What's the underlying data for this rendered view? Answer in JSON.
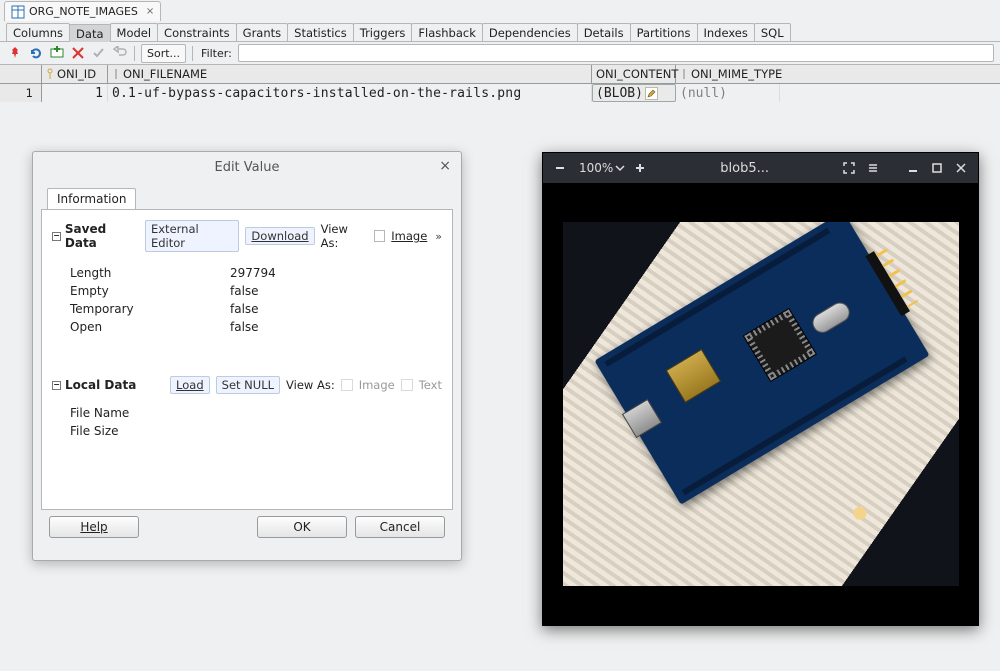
{
  "editor_tab": {
    "label": "ORG_NOTE_IMAGES"
  },
  "subtabs": [
    "Columns",
    "Data",
    "Model",
    "Constraints",
    "Grants",
    "Statistics",
    "Triggers",
    "Flashback",
    "Dependencies",
    "Details",
    "Partitions",
    "Indexes",
    "SQL"
  ],
  "subtabs_active_index": 1,
  "toolbar": {
    "sort_label": "Sort...",
    "filter_label": "Filter:",
    "filter_value": ""
  },
  "grid": {
    "columns": [
      "ONI_ID",
      "ONI_FILENAME",
      "ONI_CONTENT",
      "ONI_MIME_TYPE"
    ],
    "row_number": "1",
    "cells": {
      "oni_id": "1",
      "oni_filename": "0.1-uf-bypass-capacitors-installed-on-the-rails.png",
      "oni_content": "(BLOB)",
      "oni_mime_type": "(null)"
    }
  },
  "dialog": {
    "title": "Edit Value",
    "tab": "Information",
    "saved_data_label": "Saved Data",
    "external_editor": "External Editor",
    "download": "Download",
    "view_as": "View As:",
    "image": "Image",
    "rows": {
      "length_k": "Length",
      "length_v": "297794",
      "empty_k": "Empty",
      "empty_v": "false",
      "temp_k": "Temporary",
      "temp_v": "false",
      "open_k": "Open",
      "open_v": "false"
    },
    "local_data_label": "Local Data",
    "load": "Load",
    "set_null": "Set NULL",
    "text": "Text",
    "file_name_k": "File Name",
    "file_size_k": "File Size",
    "help": "Help",
    "ok": "OK",
    "cancel": "Cancel"
  },
  "viewer": {
    "zoom": "100%",
    "title": "blob5..."
  }
}
